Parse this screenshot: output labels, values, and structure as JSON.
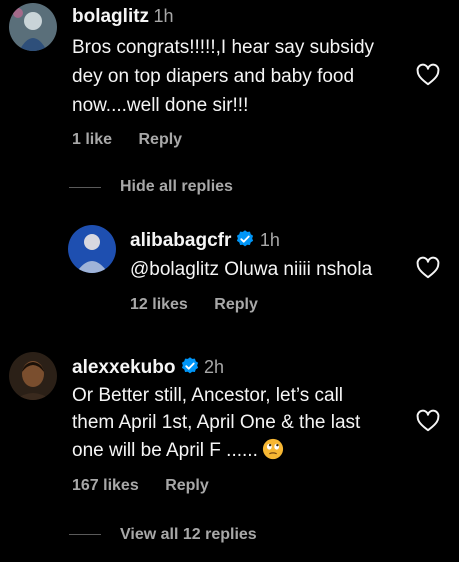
{
  "comments": [
    {
      "username": "bolaglitz",
      "time": "1h",
      "lines": [
        "Bros congrats!!!!!,I hear say subsidy",
        "dey on top diapers and baby food",
        "now....well done sir!!!"
      ],
      "likes": "1 like",
      "reply_label": "Reply",
      "toggle_replies": "Hide all replies"
    },
    {
      "username": "alibabagcfr",
      "time": "1h",
      "verified": true,
      "lines": [
        "@bolaglitz Oluwa niiii nshola"
      ],
      "likes": "12 likes",
      "reply_label": "Reply"
    },
    {
      "username": "alexxekubo",
      "time": "2h",
      "verified": true,
      "lines": [
        "Or Better still, Ancestor, let’s call",
        "them April 1st, April One & the last",
        "one will be April F ......"
      ],
      "emoji": "face-with-rolling-eyes",
      "likes": "167 likes",
      "reply_label": "Reply",
      "toggle_replies": "View all 12 replies"
    }
  ],
  "colors": {
    "background": "#000000",
    "primary_text": "#f5f5f5",
    "secondary_text": "#a8a8a8",
    "verified_blue": "#0095f6"
  },
  "icons": [
    "heart-outline-icon",
    "verified-badge-icon"
  ]
}
